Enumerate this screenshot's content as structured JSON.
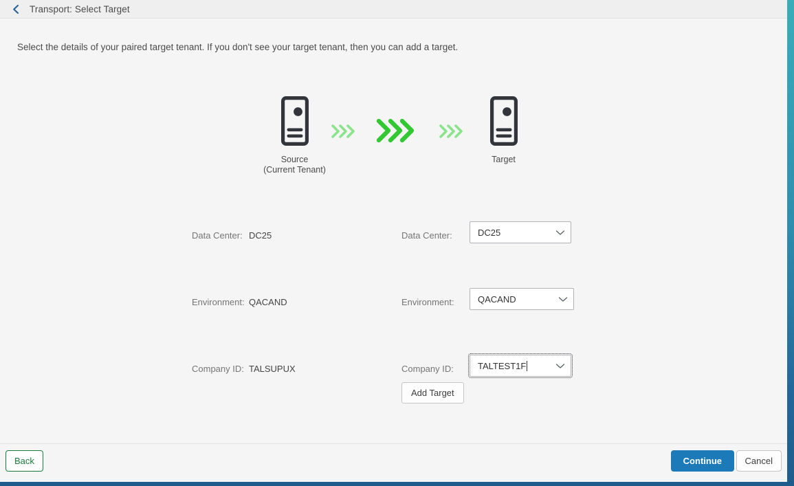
{
  "header": {
    "title": "Transport: Select Target",
    "back_icon": "chevron-left-icon"
  },
  "intro": {
    "text": "Select the details of your paired target tenant. If you don't see your target tenant, then you can add a target."
  },
  "diagram": {
    "source": {
      "icon": "tenant-server-icon",
      "caption_line1": "Source",
      "caption_line2": "(Current Tenant)"
    },
    "target": {
      "icon": "tenant-server-icon",
      "caption_line1": "Target",
      "caption_line2": ""
    },
    "arrows": {
      "icon": "triple-chevron-right-icon",
      "color_pale": "#8be38b",
      "color_bright": "#32c832"
    }
  },
  "form": {
    "rows": [
      {
        "source_label": "Data Center:",
        "source_value": "DC25",
        "target_label": "Data Center:",
        "target_value": "DC25"
      },
      {
        "source_label": "Environment:",
        "source_value": "QACAND",
        "target_label": "Environment:",
        "target_value": "QACAND"
      },
      {
        "source_label": "Company ID:",
        "source_value": "TALSUPUX",
        "target_label": "Company ID:",
        "target_value": "TALTEST1F"
      }
    ],
    "add_target_label": "Add Target",
    "dropdown_icon": "chevron-down-icon"
  },
  "footer": {
    "back_label": "Back",
    "continue_label": "Continue",
    "cancel_label": "Cancel"
  },
  "colors": {
    "accent_blue": "#1d7ab8",
    "accent_green": "#1b7a3e",
    "arrow_green": "#32c832",
    "edge_top": "#3aadb9",
    "edge_bottom": "#1f5c8b"
  }
}
